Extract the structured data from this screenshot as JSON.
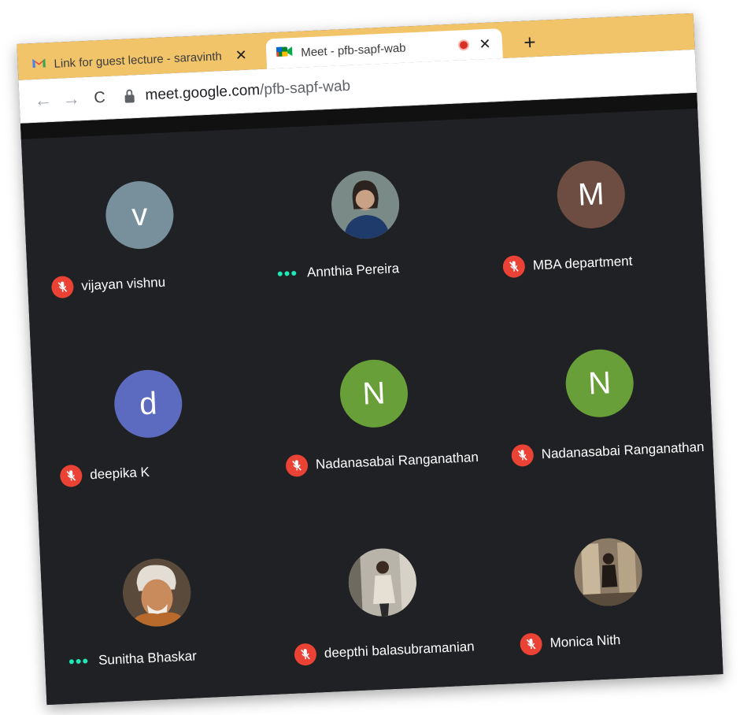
{
  "browser": {
    "tabs": [
      {
        "label": "Link for guest lecture - saravinth",
        "close_glyph": "✕",
        "icon": "gmail-icon"
      },
      {
        "label": "Meet - pfb-sapf-wab",
        "close_glyph": "✕",
        "icon": "google-meet-icon"
      }
    ],
    "new_tab_glyph": "+",
    "nav": {
      "back": "←",
      "forward": "→",
      "reload": "C"
    },
    "url_host": "meet.google.com",
    "url_path": "/pfb-sapf-wab"
  },
  "participants": [
    {
      "name": "vijayan vishnu",
      "initial": "v",
      "avatar_color": "#78909c",
      "status": "muted"
    },
    {
      "name": "Annthia Pereira",
      "initial": "",
      "avatar_color": "#5d6b6a",
      "status": "speaking"
    },
    {
      "name": "MBA department",
      "initial": "M",
      "avatar_color": "#6d4c41",
      "status": "muted"
    },
    {
      "name": "deepika K",
      "initial": "d",
      "avatar_color": "#5c6bc0",
      "status": "muted"
    },
    {
      "name": "Nadanasabai Ranganathan",
      "initial": "N",
      "avatar_color": "#689f38",
      "status": "muted"
    },
    {
      "name": "Nadanasabai Ranganathan",
      "initial": "N",
      "avatar_color": "#689f38",
      "status": "muted"
    },
    {
      "name": "Sunitha Bhaskar",
      "initial": "",
      "avatar_color": "#8d6e63",
      "status": "speaking"
    },
    {
      "name": "deepthi balasubramanian",
      "initial": "",
      "avatar_color": "#9e9e9e",
      "status": "muted"
    },
    {
      "name": "Monica Nith",
      "initial": "",
      "avatar_color": "#7b6a58",
      "status": "muted"
    }
  ],
  "colors": {
    "tabstrip": "#f2c46a",
    "meet_bg": "#202124",
    "mute_red": "#ea4335",
    "speaking_teal": "#1de9b6"
  }
}
